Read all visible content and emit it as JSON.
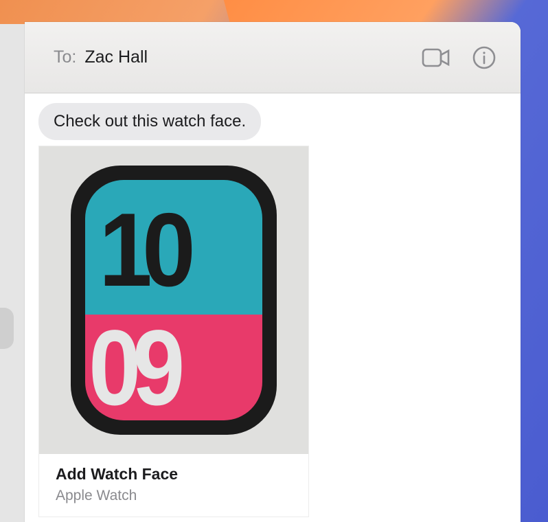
{
  "header": {
    "to_label": "To:",
    "recipient": "Zac Hall",
    "icons": {
      "facetime": "facetime-icon",
      "info": "info-icon"
    }
  },
  "conversation": {
    "incoming_message": "Check out this watch face.",
    "attachment": {
      "title": "Add Watch Face",
      "subtitle": "Apple Watch",
      "preview_digits_top": "10",
      "preview_digits_bottom": "09"
    }
  }
}
